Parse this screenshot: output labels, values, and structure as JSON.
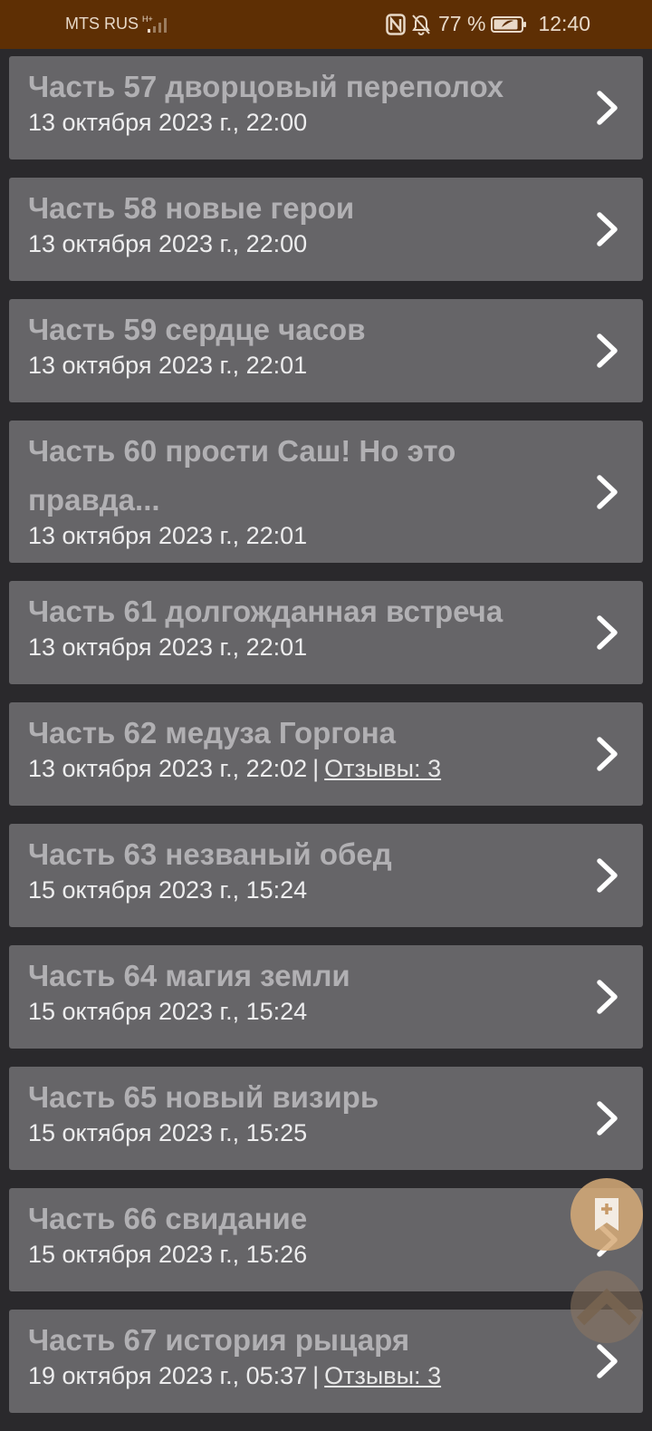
{
  "status_bar": {
    "carrier": "MTS RUS",
    "network_tag": "H+",
    "battery_percent": "77 %",
    "time": "12:40",
    "icons": [
      "signal-icon",
      "nfc-icon",
      "bell-off-icon",
      "battery-icon"
    ]
  },
  "chapters": [
    {
      "title": "Часть 57 дворцовый переполох",
      "date": "13 октября 2023 г., 22:00",
      "reviews": null
    },
    {
      "title": "Часть 58 новые герои",
      "date": "13 октября 2023 г., 22:00",
      "reviews": null
    },
    {
      "title": "Часть 59 сердце часов",
      "date": "13 октября 2023 г., 22:01",
      "reviews": null
    },
    {
      "title": "Часть 60 прости Саш! Но это правда...",
      "date": "13 октября 2023 г., 22:01",
      "reviews": null
    },
    {
      "title": "Часть 61 долгожданная встреча",
      "date": "13 октября 2023 г., 22:01",
      "reviews": null
    },
    {
      "title": "Часть 62 медуза Горгона",
      "date": "13 октября 2023 г., 22:02",
      "separator": "|",
      "reviews": "Отзывы: 3"
    },
    {
      "title": "Часть 63 незваный обед",
      "date": "15 октября 2023 г., 15:24",
      "reviews": null
    },
    {
      "title": "Часть 64 магия земли",
      "date": "15 октября 2023 г., 15:24",
      "reviews": null
    },
    {
      "title": "Часть 65 новый визирь",
      "date": "15 октября 2023 г., 15:25",
      "reviews": null
    },
    {
      "title": "Часть 66 свидание",
      "date": "15 октября 2023 г., 15:26",
      "reviews": null
    },
    {
      "title": "Часть 67 история рыцаря",
      "date": "19 октября 2023 г., 05:37",
      "separator": "|",
      "reviews": "Отзывы: 3"
    }
  ],
  "fab": {
    "bookmark_icon": "bookmark-add-icon",
    "scroll_up_icon": "chevron-up-icon"
  },
  "colors": {
    "status_bar": "#5e2f04",
    "background": "#2a292c",
    "card": "#666568",
    "title_text": "#b1b0b3",
    "meta_text": "#ededee",
    "fab_bookmark": "#d6aa78"
  }
}
